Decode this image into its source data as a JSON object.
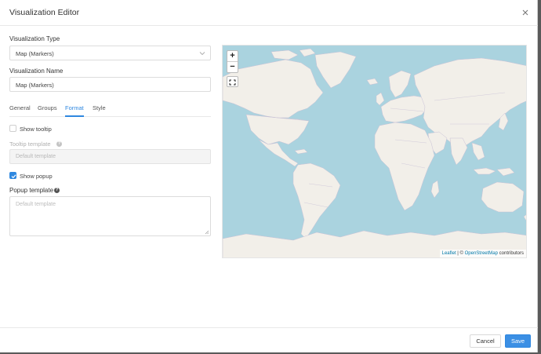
{
  "dialog": {
    "title": "Visualization Editor"
  },
  "form": {
    "type_label": "Visualization Type",
    "type_value": "Map (Markers)",
    "name_label": "Visualization Name",
    "name_value": "Map (Markers)"
  },
  "tabs": [
    {
      "label": "General",
      "active": false
    },
    {
      "label": "Groups",
      "active": false
    },
    {
      "label": "Format",
      "active": true
    },
    {
      "label": "Style",
      "active": false
    }
  ],
  "format": {
    "show_tooltip_label": "Show tooltip",
    "show_tooltip_checked": false,
    "tooltip_template_label": "Tooltip template",
    "tooltip_template_placeholder": "Default template",
    "show_popup_label": "Show popup",
    "show_popup_checked": true,
    "popup_template_label": "Popup template",
    "popup_template_placeholder": "Default template"
  },
  "map": {
    "zoom_in": "+",
    "zoom_out": "−",
    "attribution_leaflet": "Leaflet",
    "attribution_sep": " | © ",
    "attribution_osm": "OpenStreetMap",
    "attribution_suffix": " contributors",
    "colors": {
      "water": "#aad3df",
      "land": "#f2efe9",
      "border": "#c9c2d6"
    }
  },
  "footer": {
    "cancel_label": "Cancel",
    "save_label": "Save"
  },
  "accent_color": "#2f88e0"
}
